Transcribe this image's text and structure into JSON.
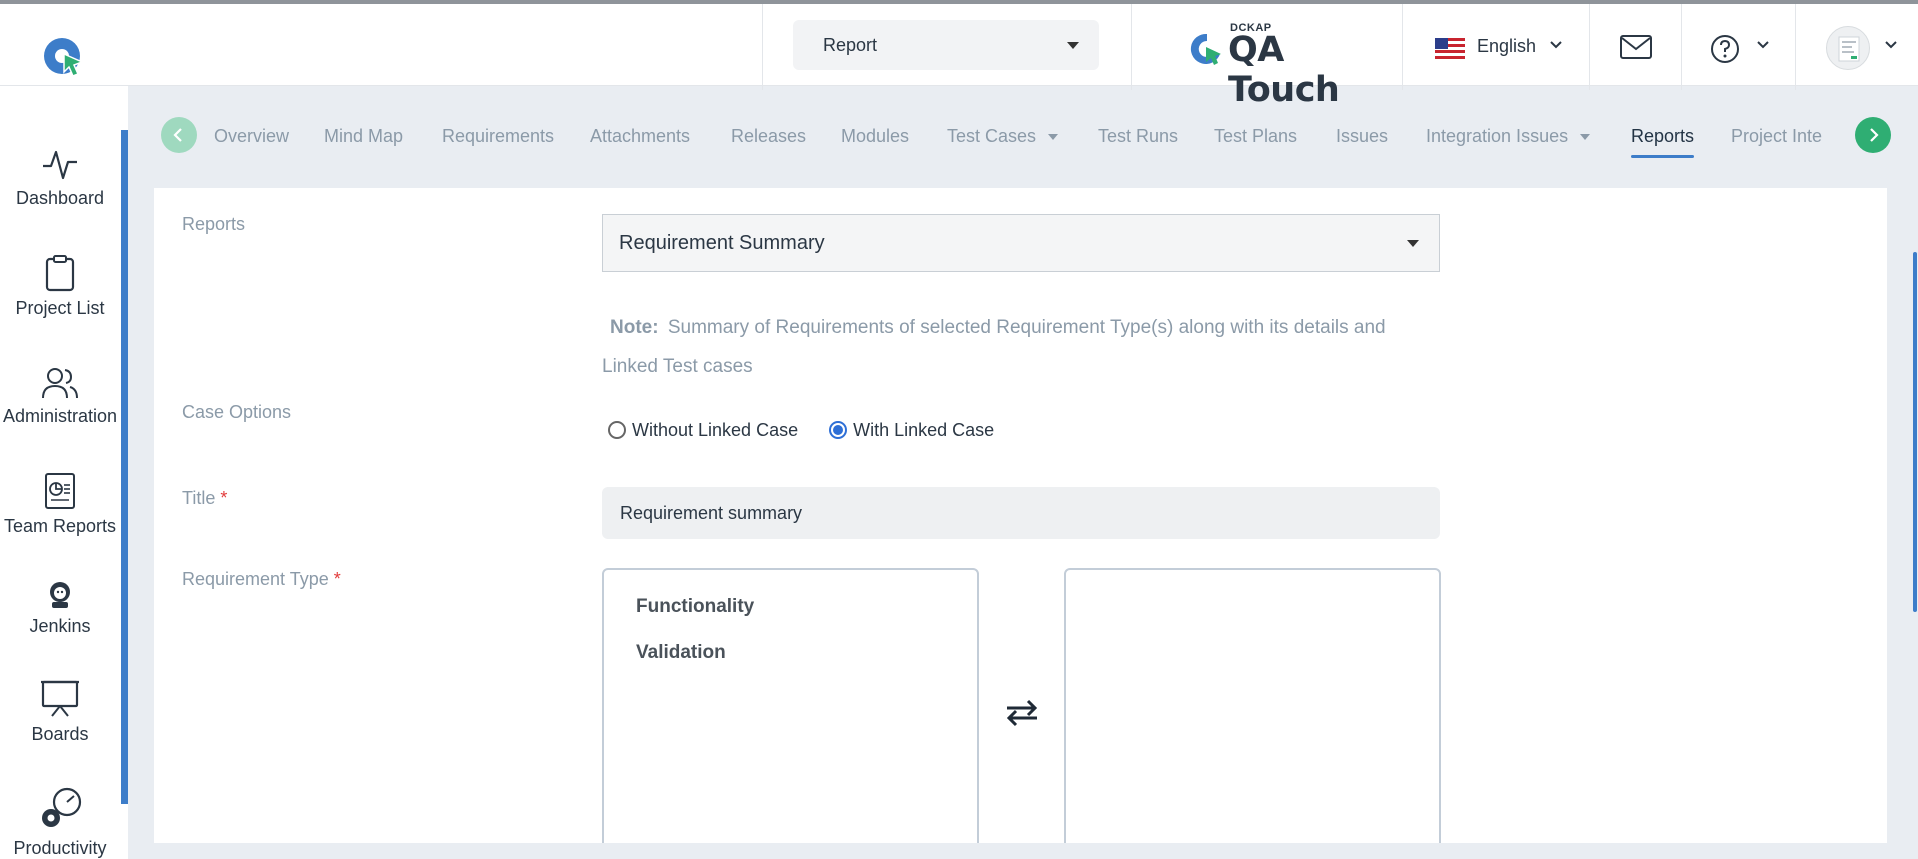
{
  "header": {
    "report_select": "Report",
    "brand_small": "DCKAP",
    "brand_name": "QA Touch",
    "language": "English"
  },
  "sidebar": {
    "items": [
      {
        "label": "Dashboard",
        "icon": "activity-icon"
      },
      {
        "label": "Project List",
        "icon": "clipboard-icon"
      },
      {
        "label": "Administration",
        "icon": "users-icon"
      },
      {
        "label": "Team Reports",
        "icon": "report-chart-icon"
      },
      {
        "label": "Jenkins",
        "icon": "jenkins-icon"
      },
      {
        "label": "Boards",
        "icon": "presentation-board-icon"
      },
      {
        "label": "Productivity",
        "icon": "productivity-gauge-icon"
      }
    ]
  },
  "tabs": [
    {
      "label": "Overview"
    },
    {
      "label": "Mind Map"
    },
    {
      "label": "Requirements"
    },
    {
      "label": "Attachments"
    },
    {
      "label": "Releases"
    },
    {
      "label": "Modules"
    },
    {
      "label": "Test Cases"
    },
    {
      "label": "Test Runs"
    },
    {
      "label": "Test Plans"
    },
    {
      "label": "Issues"
    },
    {
      "label": "Integration Issues"
    },
    {
      "label": "Reports"
    },
    {
      "label": "Project Inte"
    }
  ],
  "form": {
    "reports_label": "Reports",
    "reports_value": "Requirement Summary",
    "note_label": "Note:",
    "note_text": "Summary of Requirements of selected Requirement Type(s) along with its details and Linked Test cases",
    "case_options_label": "Case Options",
    "case_option_without": "Without Linked Case",
    "case_option_with": "With Linked Case",
    "title_label": "Title",
    "title_value": "Requirement summary",
    "req_type_label": "Requirement Type",
    "required_mark": "*",
    "available_types": [
      "Functionality",
      "Validation"
    ]
  },
  "colors": {
    "accent": "#3d7dc9",
    "nav_green": "#2fae73",
    "required": "#e23b3b"
  }
}
